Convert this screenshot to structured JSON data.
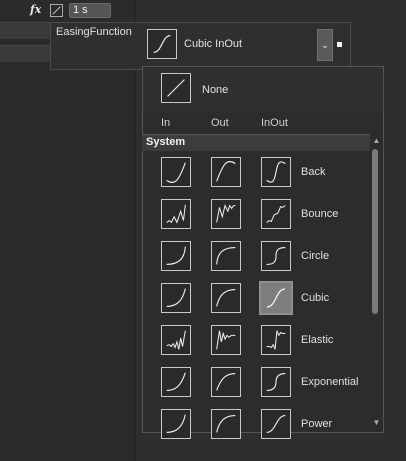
{
  "property_row": {
    "fx_icon": "fx",
    "duration": "1 s"
  },
  "property": {
    "label": "EasingFunction",
    "selected": "Cubic InOut",
    "dropdown_icon": "chevron-down-icon"
  },
  "dropdown": {
    "none_label": "None",
    "columns": [
      "In",
      "Out",
      "InOut"
    ],
    "section": "System",
    "items": [
      {
        "label": "Back"
      },
      {
        "label": "Bounce"
      },
      {
        "label": "Circle"
      },
      {
        "label": "Cubic"
      },
      {
        "label": "Elastic"
      },
      {
        "label": "Exponential"
      },
      {
        "label": "Power"
      }
    ],
    "selected_item": "Cubic",
    "selected_mode": "InOut"
  },
  "scrollbar": {
    "up": "▲",
    "down": "▼"
  },
  "colors": {
    "background": "#2e2e2e",
    "panel": "#2c2c2c",
    "icon_border": "#c8c8c8",
    "selected_bg": "#7d7d7d"
  }
}
